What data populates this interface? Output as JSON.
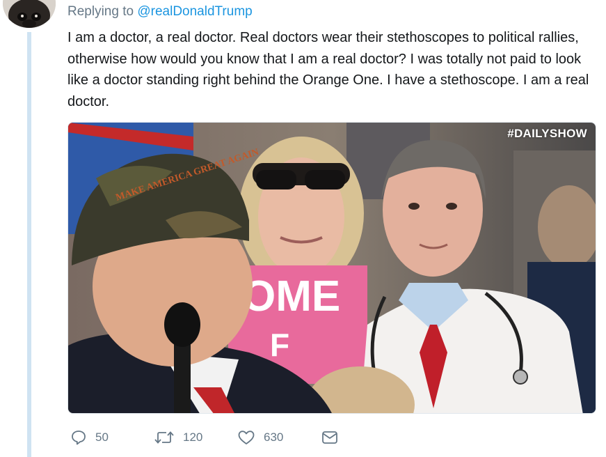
{
  "tweet": {
    "replying_prefix": "Replying to ",
    "replying_to": "@realDonaldTrump",
    "text": "I am a doctor, a real doctor. Real doctors wear their stethoscopes to political rallies, otherwise how would you know that I am a real doctor? I was totally not paid to look like a doctor standing right behind the Orange One. I have a stethoscope. I am a real doctor.",
    "media": {
      "watermark": "#DAILYSHOW",
      "hat_text": "MAKE AMERICA GREAT AGAIN",
      "sign_text_main": "OME",
      "sign_text_sub": "F"
    }
  },
  "actions": {
    "reply": {
      "icon": "reply-icon",
      "count": "50"
    },
    "retweet": {
      "icon": "retweet-icon",
      "count": "120"
    },
    "like": {
      "icon": "heart-icon",
      "count": "630"
    },
    "message": {
      "icon": "envelope-icon"
    }
  },
  "colors": {
    "mention": "#1b95e0",
    "muted": "#657786",
    "thread_line": "#cfe3f2",
    "text": "#14171a"
  }
}
